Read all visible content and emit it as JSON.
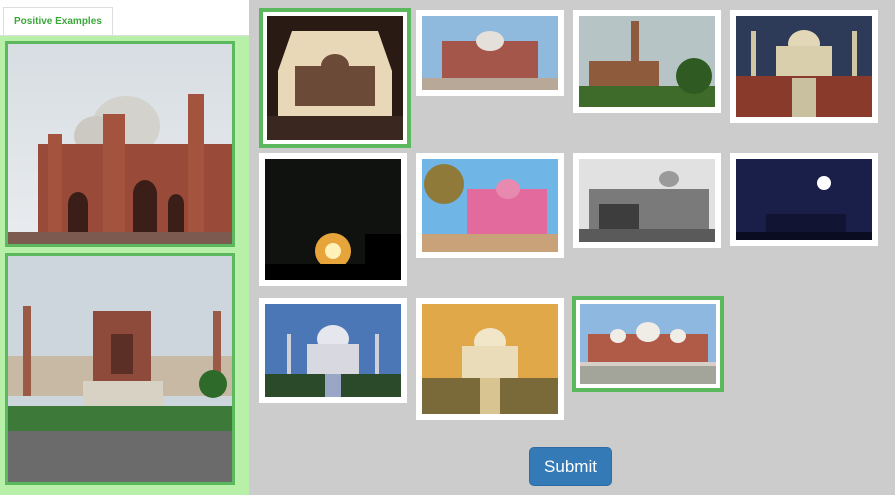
{
  "sidebar": {
    "tab_label": "Positive Examples",
    "examples": [
      {
        "name": "positive-example-mosque-domes"
      },
      {
        "name": "positive-example-gateway-mosque"
      }
    ]
  },
  "grid": {
    "images": [
      {
        "name": "image-taj-through-frame",
        "selected": true
      },
      {
        "name": "image-red-mosque",
        "selected": false
      },
      {
        "name": "image-minaret-ruin",
        "selected": false
      },
      {
        "name": "image-taj-pool-view",
        "selected": false
      },
      {
        "name": "image-sunset-silhouette",
        "selected": false
      },
      {
        "name": "image-pink-palace",
        "selected": false
      },
      {
        "name": "image-bw-cityscape",
        "selected": false
      },
      {
        "name": "image-taj-moonlight",
        "selected": false
      },
      {
        "name": "image-taj-blue-sky",
        "selected": false
      },
      {
        "name": "image-taj-golden-sky",
        "selected": false
      },
      {
        "name": "image-mosque-crowd",
        "selected": true
      }
    ]
  },
  "actions": {
    "submit_label": "Submit"
  },
  "colors": {
    "selected_border": "#5cb85c",
    "submit_bg": "#337ab7",
    "positive_panel_bg": "#b9f0a9"
  }
}
